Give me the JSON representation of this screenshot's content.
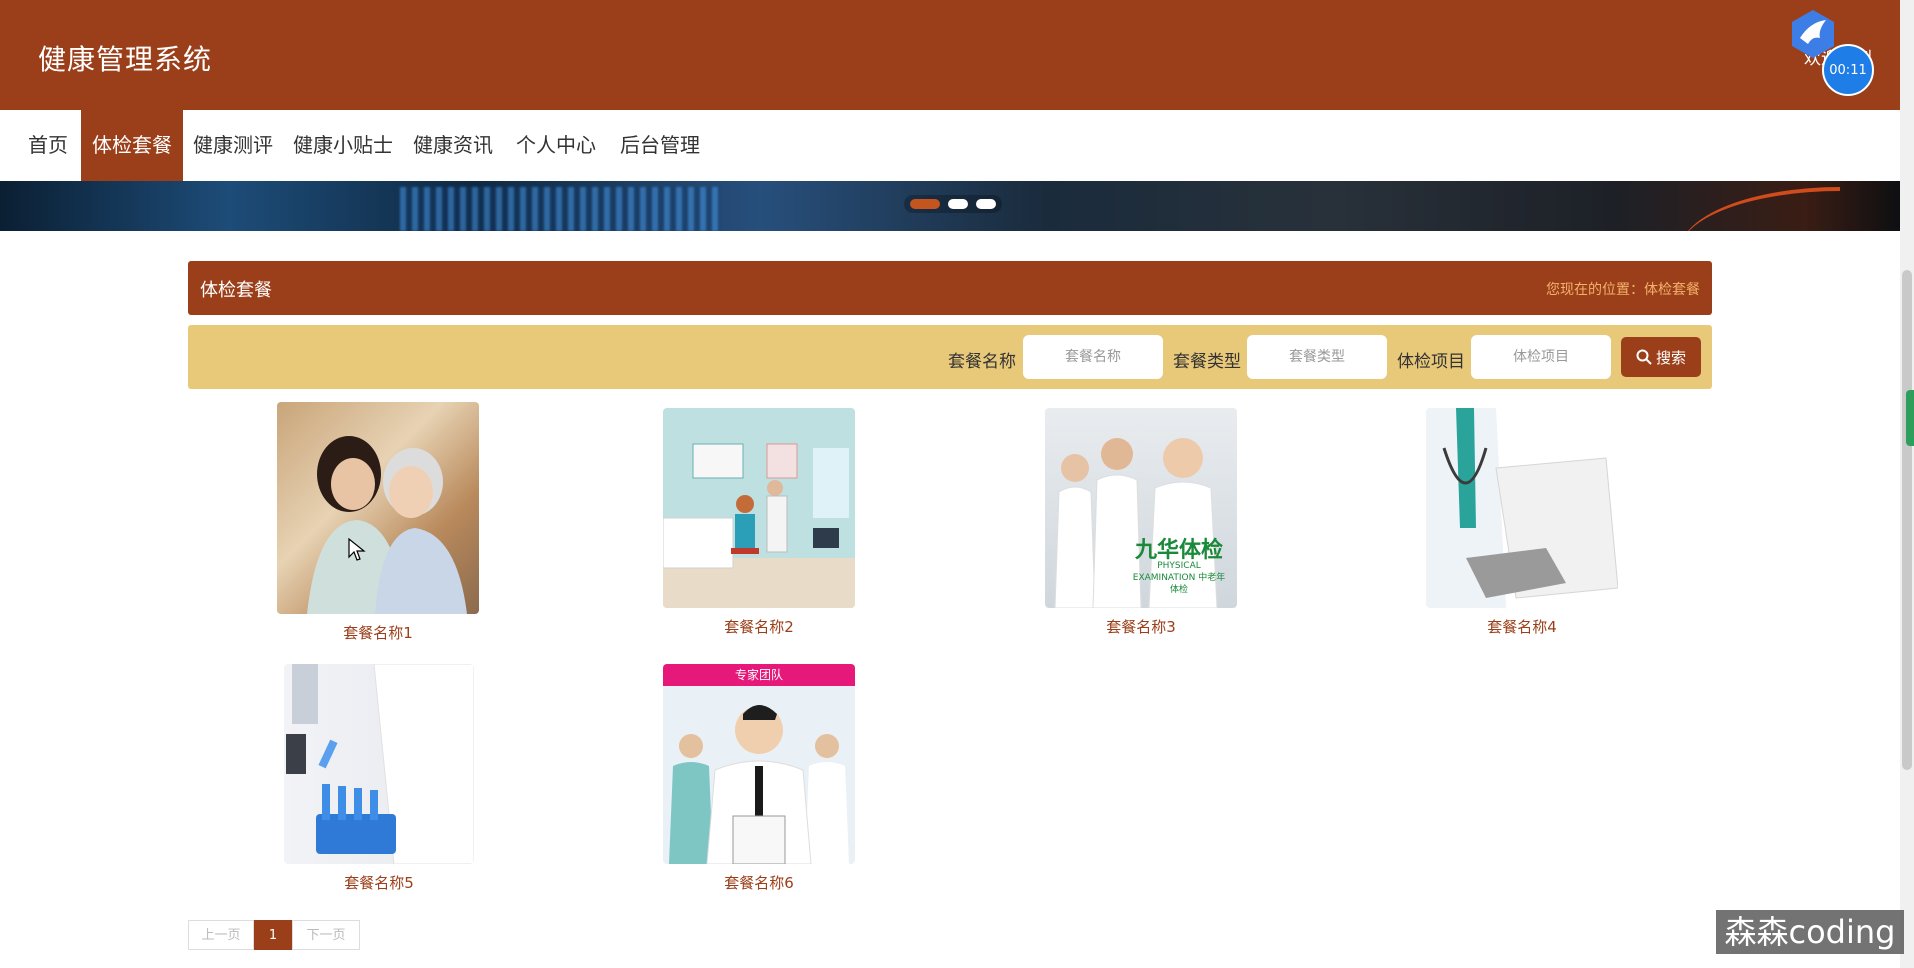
{
  "header": {
    "title": "健康管理系统",
    "welcome": "欢迎来到",
    "timer": "00:11"
  },
  "nav": {
    "items": [
      "首页",
      "体检套餐",
      "健康测评",
      "健康小贴士",
      "健康资讯",
      "个人中心",
      "后台管理"
    ],
    "active": "体检套餐"
  },
  "section": {
    "title": "体检套餐",
    "location": "您现在的位置：体检套餐"
  },
  "search": {
    "name_label": "套餐名称",
    "name_placeholder": "套餐名称",
    "type_label": "套餐类型",
    "type_placeholder": "套餐类型",
    "item_label": "体检项目",
    "item_placeholder": "体检项目",
    "button_label": "搜索"
  },
  "packages": [
    {
      "name": "套餐名称1"
    },
    {
      "name": "套餐名称2"
    },
    {
      "name": "套餐名称3",
      "image_text": "九华体检",
      "image_subtext": "PHYSICAL EXAMINATION 中老年体检"
    },
    {
      "name": "套餐名称4"
    },
    {
      "name": "套餐名称5"
    },
    {
      "name": "套餐名称6",
      "image_text": "专家团队"
    }
  ],
  "pagination": {
    "prev": "上一页",
    "current": "1",
    "next": "下一页"
  },
  "watermark": "森森coding",
  "colors": {
    "primary": "#9b3f1a",
    "search_bar": "#e8c97a",
    "location_text": "#f3b16a"
  }
}
